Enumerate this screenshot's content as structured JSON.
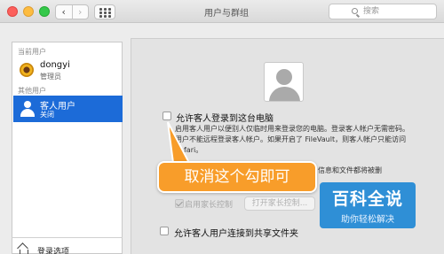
{
  "window": {
    "title": "用户与群组",
    "nav_back": "‹",
    "nav_forward": "›",
    "search_placeholder": "搜索"
  },
  "sidebar": {
    "current_users_label": "当前用户",
    "current_user": {
      "name": "dongyi",
      "role": "管理员"
    },
    "other_users_label": "其他用户",
    "guest_user": {
      "name": "客人用户",
      "status": "关闭"
    },
    "login_options_label": "登录选项"
  },
  "main": {
    "allow_guest_login": {
      "label": "允许客人登录到这台电脑",
      "checked": false
    },
    "description_lines": [
      "启用客人用户以便别人仅临时用来登录您的电脑。登录客人帐户无需密码。",
      "用户不能远程登录客人帐户。如果开启了 FileVault，则客人帐户只能访问",
      "Safari。"
    ],
    "description_tail": "信息和文件都将被删",
    "parental_controls": {
      "label": "启用家长控制",
      "checked": true
    },
    "open_parental_controls_button": "打开家长控制...",
    "allow_shared_folders": {
      "label": "允许客人用户连接到共享文件夹",
      "checked": false
    }
  },
  "annotation": {
    "callout_text": "取消这个勾即可",
    "callout_color": "#f89d2a"
  },
  "watermark": {
    "title": "百科全说",
    "subtitle": "助你轻松解决",
    "color": "#2f8fd6"
  }
}
